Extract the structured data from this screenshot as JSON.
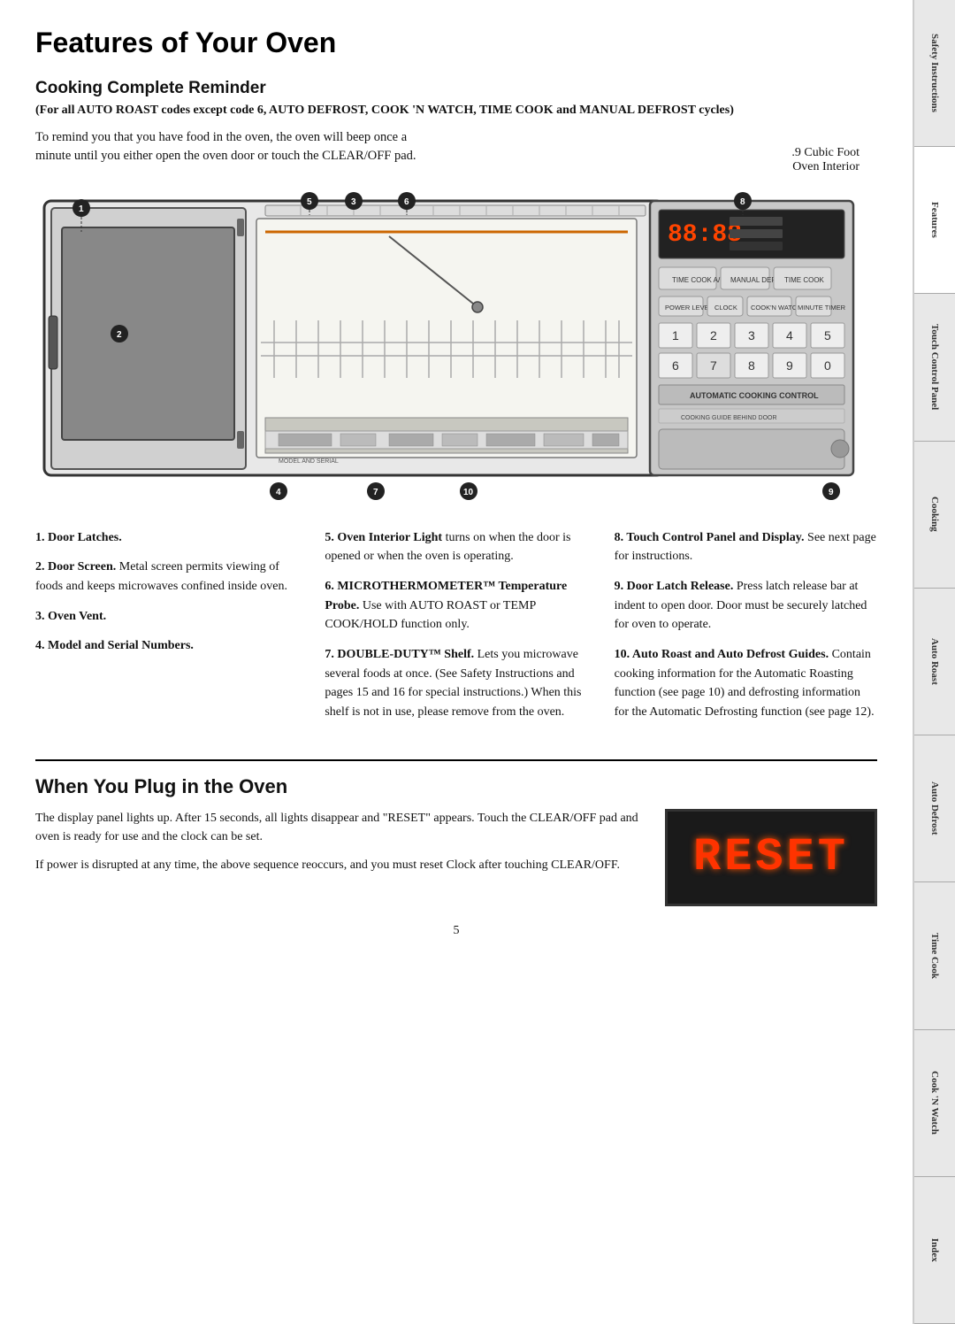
{
  "page": {
    "title": "Features of Your Oven",
    "page_number": "5"
  },
  "cooking_complete": {
    "heading": "Cooking Complete Reminder",
    "subheading": "(For all AUTO ROAST codes except code 6, AUTO DEFROST, COOK 'N WATCH, TIME COOK and MANUAL DEFROST cycles)",
    "intro": "To remind you that you have food in the oven, the oven will beep once a minute until you either open the oven door or touch the CLEAR/OFF pad.",
    "oven_label_line1": ".9 Cubic Foot",
    "oven_label_line2": "Oven Interior"
  },
  "features": {
    "col1": [
      {
        "id": "1",
        "label": "Door Latches.",
        "detail": ""
      },
      {
        "id": "2",
        "label": "Door Screen.",
        "detail": " Metal screen permits viewing of foods and keeps microwaves confined inside oven."
      },
      {
        "id": "3",
        "label": "Oven Vent.",
        "detail": ""
      },
      {
        "id": "4",
        "label": "Model and Serial Numbers.",
        "detail": ""
      }
    ],
    "col2": [
      {
        "id": "5",
        "label": "Oven Interior Light",
        "detail": " turns on when the door is opened or when the oven is operating."
      },
      {
        "id": "6",
        "label": "MICROTHERMOMETER™ Temperature Probe.",
        "detail": " Use with AUTO ROAST or TEMP COOK/HOLD function only."
      },
      {
        "id": "7",
        "label": "DOUBLE-DUTY™ Shelf.",
        "detail": " Lets you microwave several foods at once. (See Safety Instructions and pages 15 and 16 for special instructions.) When this shelf is not in use, please remove from the oven."
      }
    ],
    "col3": [
      {
        "id": "8",
        "label": "Touch Control Panel and Display.",
        "detail": " See next page for instructions."
      },
      {
        "id": "9",
        "label": "Door Latch Release.",
        "detail": " Press latch release bar at indent to open door. Door must be securely latched for oven to operate."
      },
      {
        "id": "10",
        "label": "Auto Roast and Auto Defrost Guides.",
        "detail": " Contain cooking information for the Automatic Roasting function (see page 10) and defrosting information for the Automatic Defrosting function (see page 12)."
      }
    ]
  },
  "plug_section": {
    "heading": "When You Plug in the Oven",
    "para1": "The display panel lights up. After 15 seconds, all lights disappear and \"RESET\" appears. Touch the CLEAR/OFF pad and oven is ready for use and the clock can be set.",
    "para2": "If power is disrupted at any time, the above sequence reoccurs, and you must reset Clock after touching CLEAR/OFF.",
    "display_text": "RESET"
  },
  "side_tabs": [
    "Safety Instructions",
    "Features",
    "Touch Control Panel",
    "Cooking",
    "Auto Roast",
    "Auto Defrost",
    "Time Cook",
    "Cook 'N Watch",
    "Index"
  ]
}
